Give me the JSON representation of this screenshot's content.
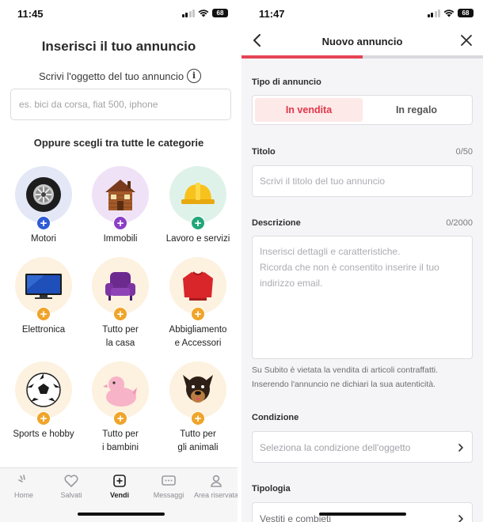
{
  "left_screen": {
    "status": {
      "time": "11:45",
      "battery": "68"
    },
    "title": "Inserisci il tuo annuncio",
    "subtitle": "Scrivi l'oggetto del tuo annuncio",
    "search": {
      "placeholder": "es. bici da corsa, fiat 500, iphone",
      "value": ""
    },
    "categories_heading": "Oppure scegli tra tutte le categorie",
    "categories": [
      {
        "label": "Motori",
        "icon": "tire-icon"
      },
      {
        "label": "Immobili",
        "icon": "house-icon"
      },
      {
        "label": "Lavoro e servizi",
        "icon": "hard-hat-icon"
      },
      {
        "label": "Elettronica",
        "icon": "tv-icon"
      },
      {
        "label": "Tutto per\nla casa",
        "icon": "armchair-icon"
      },
      {
        "label": "Abbigliamento\ne Accessori",
        "icon": "sweater-icon"
      },
      {
        "label": "Sports e hobby",
        "icon": "soccer-ball-icon"
      },
      {
        "label": "Tutto per\ni bambini",
        "icon": "rubber-duck-icon"
      },
      {
        "label": "Tutto per\ngli animali",
        "icon": "dog-icon"
      }
    ],
    "tabs": [
      {
        "label": "Home",
        "icon": "home-icon",
        "active": false
      },
      {
        "label": "Salvati",
        "icon": "heart-icon",
        "active": false
      },
      {
        "label": "Vendi",
        "icon": "plus-square-icon",
        "active": true
      },
      {
        "label": "Messaggi",
        "icon": "chat-icon",
        "active": false
      },
      {
        "label": "Area riservata",
        "icon": "user-icon",
        "active": false
      }
    ]
  },
  "right_screen": {
    "status": {
      "time": "11:47",
      "battery": "68"
    },
    "header": {
      "title": "Nuovo annuncio",
      "back_icon": "chevron-left-icon",
      "close_icon": "close-icon"
    },
    "progress": 0.5,
    "tipo": {
      "label": "Tipo di annuncio",
      "options": [
        "In vendita",
        "In regalo"
      ],
      "selected": "In vendita"
    },
    "titolo": {
      "label": "Titolo",
      "counter": "0/50",
      "placeholder": "Scrivi il titolo del tuo annuncio",
      "value": ""
    },
    "descrizione": {
      "label": "Descrizione",
      "counter": "0/2000",
      "placeholder": "Inserisci dettagli e caratteristiche.\nRicorda che non è consentito inserire il tuo indirizzo email.",
      "value": ""
    },
    "notice": "Su Subito è vietata la vendita di articoli contraffatti. Inserendo l'annuncio ne dichiari la sua autenticità.",
    "condizione": {
      "label": "Condizione",
      "value": "Seleziona la condizione dell'oggetto"
    },
    "tipologia": {
      "label": "Tipologia",
      "value": "Vestiti e combieti"
    }
  },
  "colors": {
    "accent_red": "#e2364a",
    "selected_bg": "#fde9e8",
    "plus_blue": "#2f5bd6",
    "plus_purple": "#8b3fc7",
    "plus_green": "#21a67a",
    "plus_orange": "#f0a429"
  }
}
